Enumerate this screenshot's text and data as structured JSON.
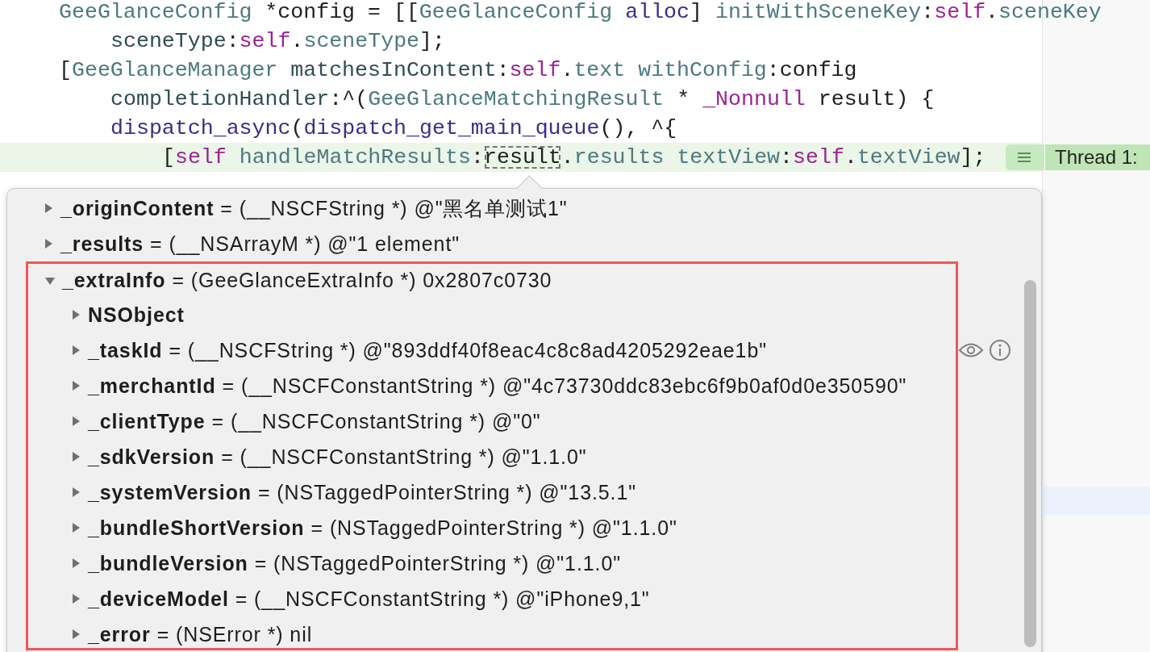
{
  "code_lines": [
    {
      "kind": "statement",
      "highlighted": false,
      "tokens": [
        {
          "text": "GeeGlanceConfig",
          "kind": "type"
        },
        {
          "text": " *config = [[",
          "kind": "plain"
        },
        {
          "text": "GeeGlanceConfig",
          "kind": "type"
        },
        {
          "text": " alloc",
          "kind": "system"
        },
        {
          "text": "] ",
          "kind": "plain"
        },
        {
          "text": "initWithSceneKey",
          "kind": "type"
        },
        {
          "text": ":",
          "kind": "plain"
        },
        {
          "text": "self",
          "kind": "keyword"
        },
        {
          "text": ".",
          "kind": "plain"
        },
        {
          "text": "sceneKey",
          "kind": "type"
        }
      ]
    },
    {
      "kind": "continuation",
      "highlighted": false,
      "tokens": [
        {
          "text": "sceneType",
          "kind": "decl"
        },
        {
          "text": ":",
          "kind": "plain"
        },
        {
          "text": "self",
          "kind": "keyword"
        },
        {
          "text": ".",
          "kind": "plain"
        },
        {
          "text": "sceneType",
          "kind": "type"
        },
        {
          "text": "];",
          "kind": "plain"
        }
      ]
    },
    {
      "kind": "statement",
      "highlighted": false,
      "tokens": [
        {
          "text": "[",
          "kind": "plain"
        },
        {
          "text": "GeeGlanceManager",
          "kind": "type"
        },
        {
          "text": " matchesInContent",
          "kind": "decl"
        },
        {
          "text": ":",
          "kind": "plain"
        },
        {
          "text": "self",
          "kind": "keyword"
        },
        {
          "text": ".",
          "kind": "plain"
        },
        {
          "text": "text",
          "kind": "type"
        },
        {
          "text": " withConfig",
          "kind": "type"
        },
        {
          "text": ":config",
          "kind": "plain"
        }
      ]
    },
    {
      "kind": "continuation",
      "highlighted": false,
      "tokens": [
        {
          "text": "completionHandler",
          "kind": "decl"
        },
        {
          "text": ":^(",
          "kind": "plain"
        },
        {
          "text": "GeeGlanceMatchingResult",
          "kind": "type"
        },
        {
          "text": " * ",
          "kind": "plain"
        },
        {
          "text": "_Nonnull",
          "kind": "keyword"
        },
        {
          "text": " result) {",
          "kind": "plain"
        }
      ]
    },
    {
      "kind": "continuation",
      "highlighted": false,
      "tokens": [
        {
          "text": "dispatch_async",
          "kind": "system"
        },
        {
          "text": "(",
          "kind": "plain"
        },
        {
          "text": "dispatch_get_main_queue",
          "kind": "system"
        },
        {
          "text": "(), ^{",
          "kind": "plain"
        }
      ]
    },
    {
      "kind": "nested",
      "highlighted": true,
      "tokens": [
        {
          "text": "[",
          "kind": "plain"
        },
        {
          "text": "self",
          "kind": "keyword"
        },
        {
          "text": " handleMatchResults",
          "kind": "type"
        },
        {
          "text": ":",
          "kind": "plain"
        },
        {
          "text": "result",
          "kind": "hover"
        },
        {
          "text": ".",
          "kind": "plain"
        },
        {
          "text": "results",
          "kind": "type"
        },
        {
          "text": " textView",
          "kind": "type"
        },
        {
          "text": ":",
          "kind": "plain"
        },
        {
          "text": "self",
          "kind": "keyword"
        },
        {
          "text": ".",
          "kind": "plain"
        },
        {
          "text": "textView",
          "kind": "type"
        },
        {
          "text": "];",
          "kind": "plain"
        }
      ]
    }
  ],
  "thread_badge": {
    "label": "Thread 1:"
  },
  "variables": [
    {
      "name": "_originContent",
      "value": "= (__NSCFString *) @\"黑名单测试1\"",
      "expanded": false,
      "highlighted": false,
      "hovered": false
    },
    {
      "name": "_results",
      "value": "= (__NSArrayM *) @\"1 element\"",
      "expanded": false,
      "highlighted": false,
      "hovered": false
    },
    {
      "name": "_extraInfo",
      "value": "= (GeeGlanceExtraInfo *) 0x2807c0730",
      "expanded": true,
      "highlighted": true,
      "hovered": false,
      "children": [
        {
          "name": "NSObject",
          "expanded": false,
          "hovered": false
        },
        {
          "name": "_taskId",
          "value": "= (__NSCFString *) @\"893ddf40f8eac4c8c8ad4205292eae1b\"",
          "expanded": false,
          "hovered": true
        },
        {
          "name": "_merchantId",
          "value": "= (__NSCFConstantString *) @\"4c73730ddc83ebc6f9b0af0d0e350590\"",
          "expanded": false,
          "hovered": false
        },
        {
          "name": "_clientType",
          "value": "= (__NSCFConstantString *) @\"0\"",
          "expanded": false,
          "hovered": false
        },
        {
          "name": "_sdkVersion",
          "value": "= (__NSCFConstantString *) @\"1.1.0\"",
          "expanded": false,
          "hovered": false
        },
        {
          "name": "_systemVersion",
          "value": "= (NSTaggedPointerString *) @\"13.5.1\"",
          "expanded": false,
          "hovered": false
        },
        {
          "name": "_bundleShortVersion",
          "value": "= (NSTaggedPointerString *) @\"1.1.0\"",
          "expanded": false,
          "hovered": false
        },
        {
          "name": "_bundleVersion",
          "value": "= (NSTaggedPointerString *) @\"1.1.0\"",
          "expanded": false,
          "hovered": false
        },
        {
          "name": "_deviceModel",
          "value": "= (__NSCFConstantString *) @\"iPhone9,1\"",
          "expanded": false,
          "hovered": false
        },
        {
          "name": "_error",
          "value": "= (NSError *) nil",
          "expanded": false,
          "hovered": false
        }
      ]
    }
  ]
}
